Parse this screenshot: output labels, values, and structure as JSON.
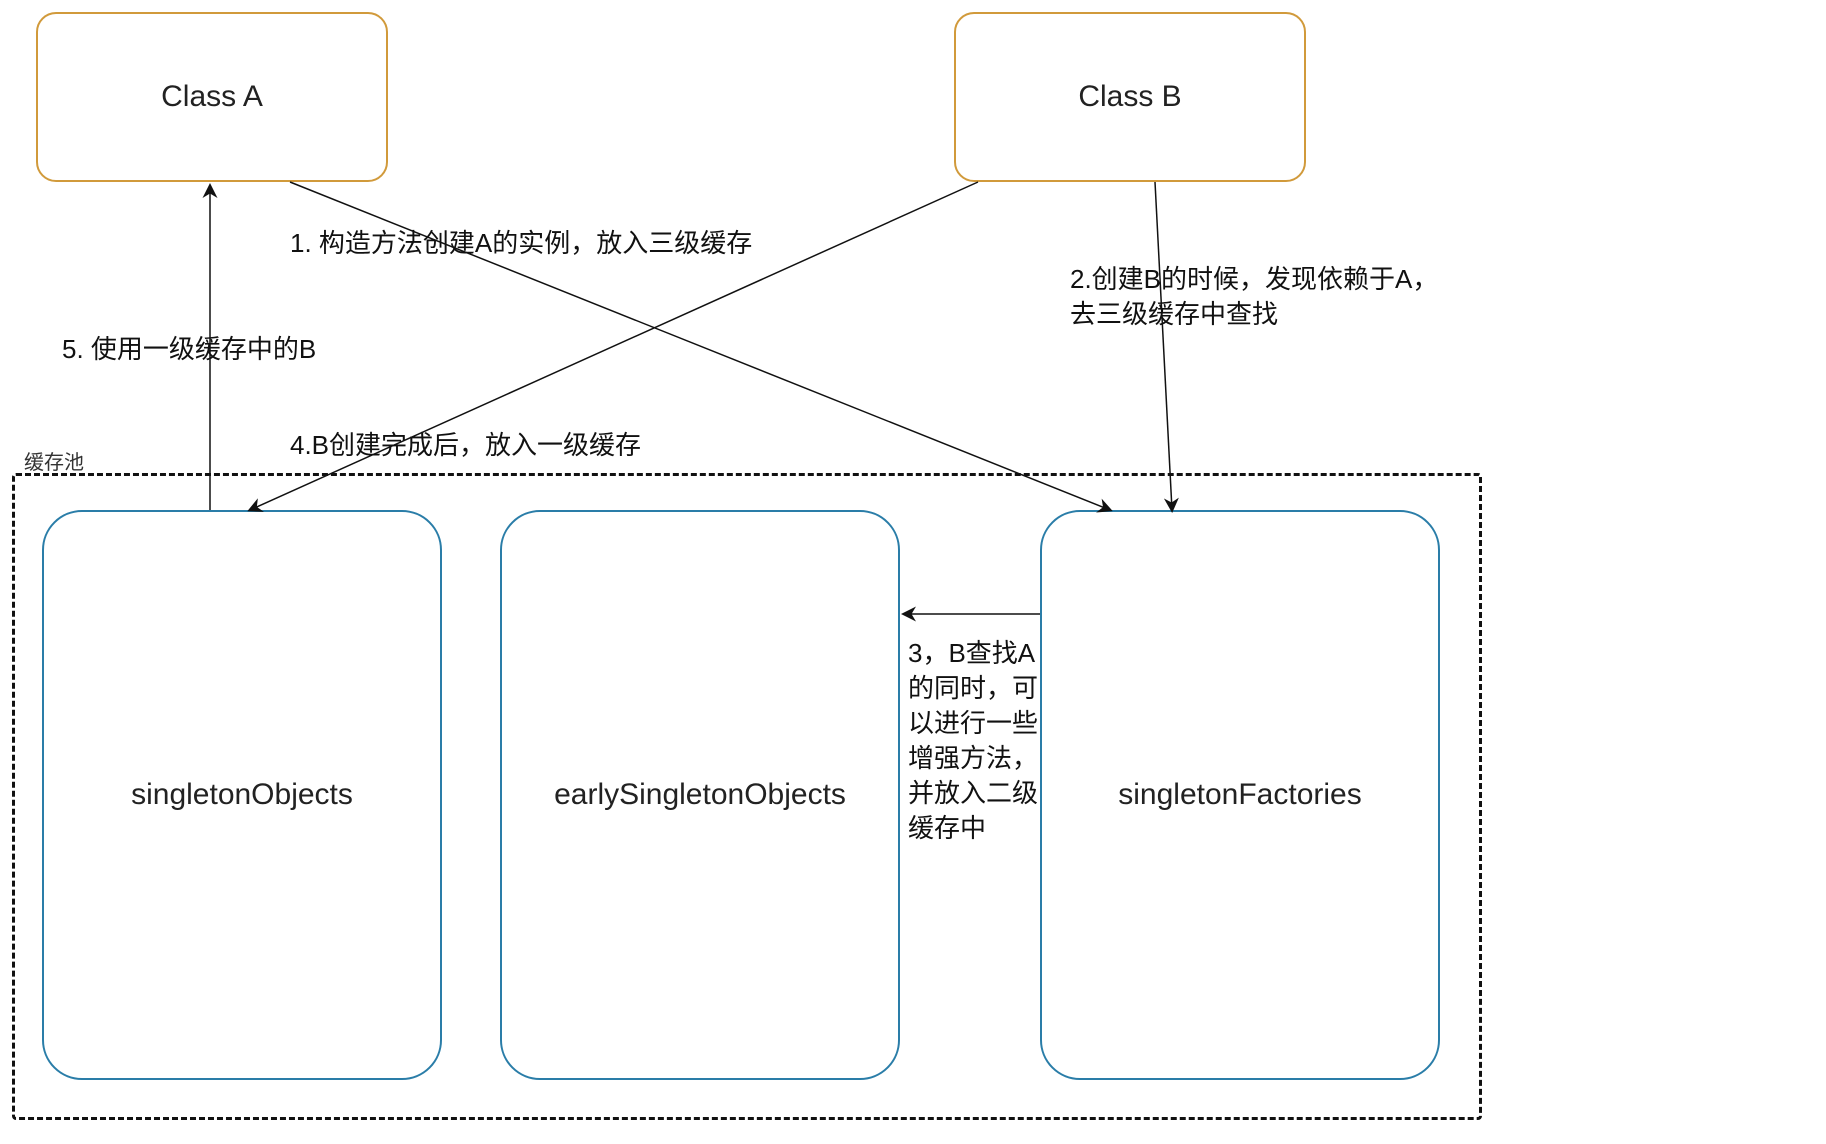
{
  "classA": {
    "label": "Class A"
  },
  "classB": {
    "label": "Class B"
  },
  "pool": {
    "label": "缓存池"
  },
  "caches": {
    "singletonObjects": {
      "label": "singletonObjects"
    },
    "earlySingletonObjects": {
      "label": "earlySingletonObjects"
    },
    "singletonFactories": {
      "label": "singletonFactories"
    }
  },
  "annotations": {
    "step1": "1. 构造方法创建A的实例，放入三级缓存",
    "step2": "2.创建B的时候，发现依赖于A，去三级缓存中查找",
    "step3": "3，B查找A的同时，可以进行一些增强方法，并放入二级缓存中",
    "step4": "4.B创建完成后，放入一级缓存",
    "step5": "5. 使用一级缓存中的B"
  }
}
